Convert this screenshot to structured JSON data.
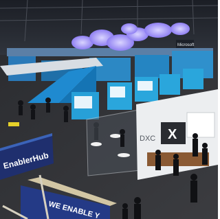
{
  "scene": {
    "signs": {
      "hanging_banner": "EnablerHub",
      "lower_banner": "WE ENABLE Y",
      "booth_logo": "DXC",
      "x_logo": "X",
      "microsoft_sign": "Microsoft"
    }
  }
}
